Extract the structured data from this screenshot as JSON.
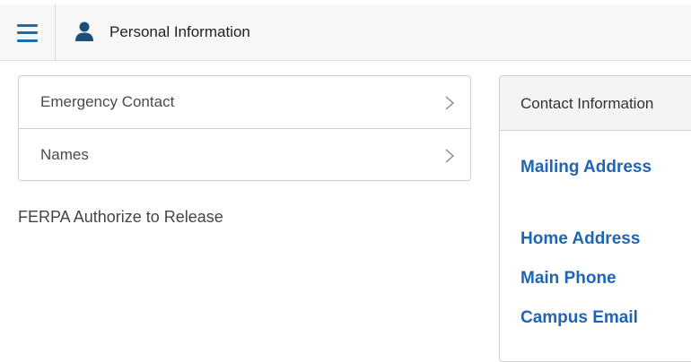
{
  "header": {
    "title": "Personal Information",
    "menu_icon": "hamburger-menu-icon",
    "title_icon": "person-icon",
    "accent_color": "#1a6fb0"
  },
  "profile_list": {
    "items": [
      {
        "label": "Emergency Contact",
        "icon": "chevron-right-icon"
      },
      {
        "label": "Names",
        "icon": "chevron-right-icon"
      }
    ]
  },
  "ferpa": {
    "label": "FERPA Authorize to Release"
  },
  "contact_info": {
    "title": "Contact Information",
    "links": [
      "Mailing Address",
      "Home Address",
      "Main Phone",
      "Campus Email"
    ],
    "link_color": "#1e66b5"
  }
}
